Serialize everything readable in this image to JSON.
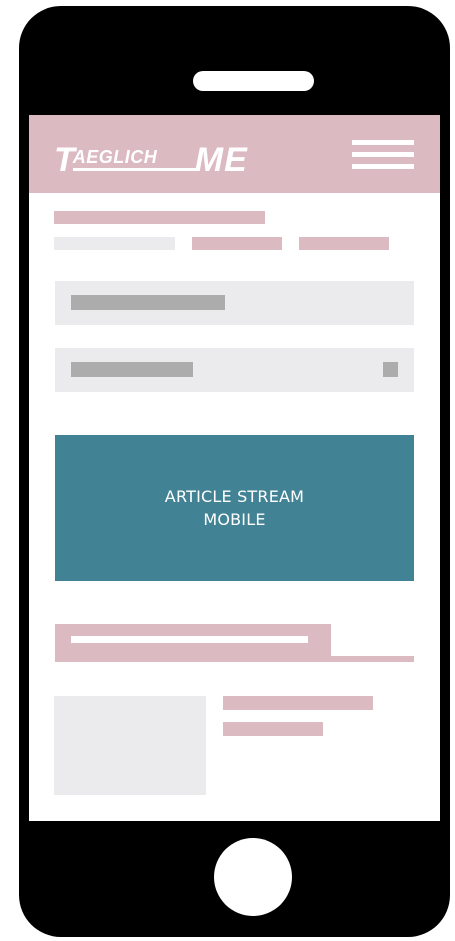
{
  "logo": {
    "letter_t": "T",
    "rest": "AEGLICH",
    "me": "ME",
    "alt": "TAEGLICH.ME"
  },
  "placeholder": {
    "line1": "ARTICLE STREAM",
    "line2": "MOBILE"
  },
  "colors": {
    "phone_body": "#000000",
    "header_pink": "#dcbac2",
    "placeholder_grey": "#ebebed",
    "text_grey": "#acacac",
    "stream_teal": "#418395"
  },
  "icons": {
    "menu": "hamburger-menu-icon"
  }
}
